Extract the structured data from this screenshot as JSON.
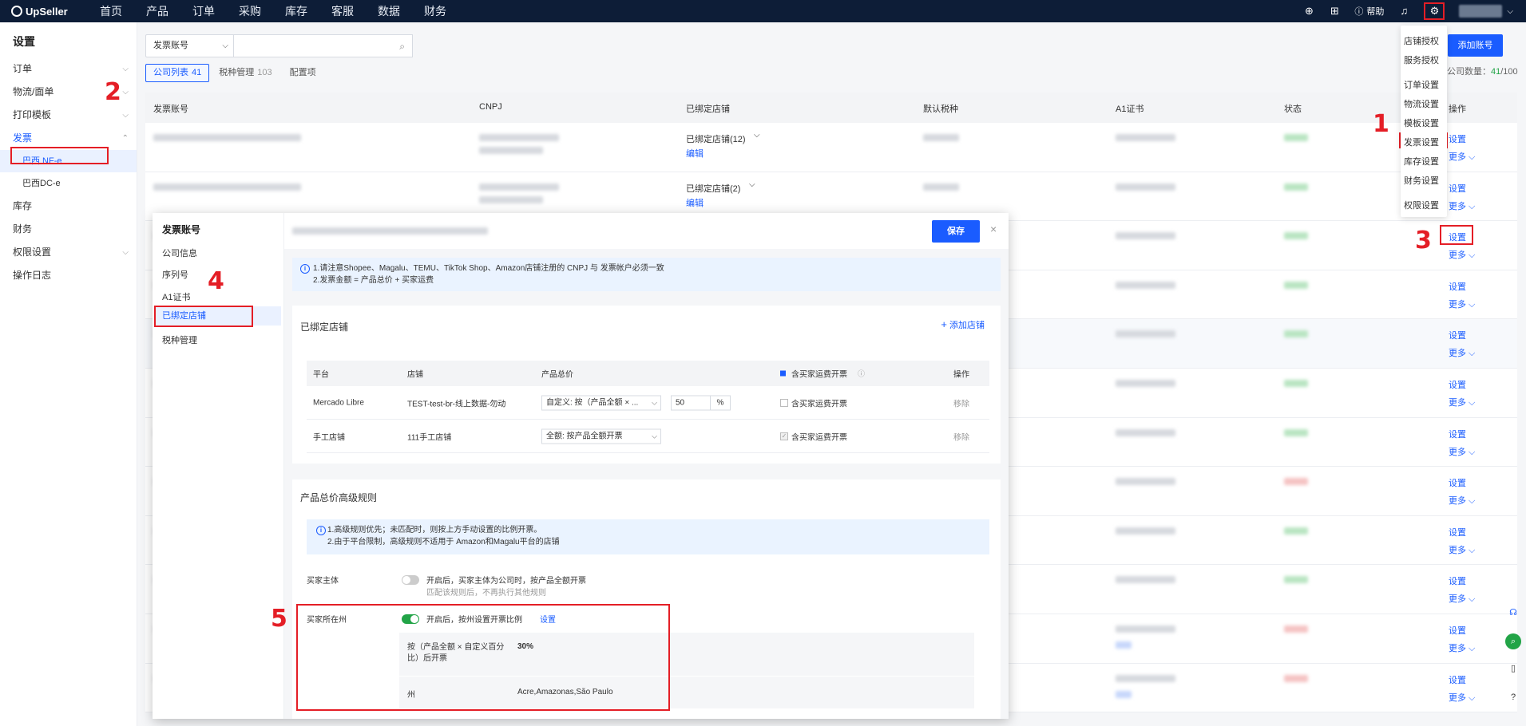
{
  "nav": {
    "logo": "UpSeller",
    "items": [
      "首页",
      "产品",
      "订单",
      "采购",
      "库存",
      "客服",
      "数据",
      "财务"
    ],
    "help": "帮助"
  },
  "sidebar": {
    "title": "设置",
    "items": [
      {
        "label": "订单",
        "chevron": "⌵"
      },
      {
        "label": "物流/面单",
        "chevron": "⌵"
      },
      {
        "label": "打印模板",
        "chevron": "⌵"
      },
      {
        "label": "发票",
        "chevron": "⌃"
      },
      {
        "label": "库存",
        "chevron": ""
      },
      {
        "label": "财务",
        "chevron": ""
      },
      {
        "label": "权限设置",
        "chevron": "⌵"
      },
      {
        "label": "操作日志",
        "chevron": ""
      }
    ],
    "subitems": [
      "巴西 NF-e",
      "巴西DC-e"
    ]
  },
  "search": {
    "type": "发票账号",
    "placeholder": ""
  },
  "tabs": [
    {
      "label": "公司列表",
      "count": "41"
    },
    {
      "label": "税种管理",
      "count": "103"
    },
    {
      "label": "配置项",
      "count": ""
    }
  ],
  "add_account": "添加账号",
  "company_count": {
    "label": "公司数量：",
    "value": "41",
    "max": "/100"
  },
  "table": {
    "headers": [
      "发票账号",
      "CNPJ",
      "已绑定店铺",
      "默认税种",
      "A1证书",
      "状态",
      "操作"
    ],
    "bound_stores": [
      "已绑定店铺(12)",
      "已绑定店铺(2)"
    ],
    "edit": "编辑",
    "set": "设置",
    "more": "更多"
  },
  "dropdown": [
    "店铺授权",
    "服务授权",
    "订单设置",
    "物流设置",
    "模板设置",
    "发票设置",
    "库存设置",
    "财务设置",
    "权限设置"
  ],
  "modal": {
    "left_title": "发票账号",
    "left_items": [
      "公司信息",
      "序列号",
      "A1证书",
      "已绑定店铺",
      "税种管理"
    ],
    "save": "保存",
    "notice": [
      "1.请注意Shopee、Magalu、TEMU、TikTok Shop、Amazon店铺注册的 CNPJ 与 发票帐户必须一致",
      "2.发票金额 = 产品总价 + 买家运费"
    ],
    "bound_title": "已绑定店铺",
    "add_store": "添加店铺",
    "store_headers": [
      "平台",
      "店铺",
      "产品总价",
      "含买家运费开票",
      "操作"
    ],
    "stores": [
      {
        "platform": "Mercado Libre",
        "store": "TEST-test-br-线上数据-勿动",
        "price_rule": "自定义: 按（产品全额 × ...",
        "percent": "50",
        "percent_unit": "%",
        "freight": "含买家运费开票",
        "action": "移除"
      },
      {
        "platform": "手工店铺",
        "store": "111手工店铺",
        "price_rule": "全额: 按产品全额开票",
        "percent": "",
        "percent_unit": "",
        "freight": "含买家运费开票",
        "action": "移除"
      }
    ],
    "adv_title": "产品总价高级规则",
    "adv_notice": [
      "1.高级规则优先；未匹配时，则按上方手动设置的比例开票。",
      "2.由于平台限制，高级规则不适用于 Amazon和Magalu平台的店铺"
    ],
    "buyer_entity": {
      "label": "买家主体",
      "text": "开启后，买家主体为公司时，按产品全额开票",
      "sub": "匹配该规则后，不再执行其他规则"
    },
    "buyer_state": {
      "label": "买家所在州",
      "text": "开启后，按州设置开票比例",
      "link": "设置"
    },
    "rule_rows": [
      {
        "label": "按（产品全额 × 自定义百分比）后开票",
        "value": "30%"
      },
      {
        "label": "州",
        "value": "Acre,Amazonas,São Paulo"
      }
    ]
  },
  "annotations": [
    "1",
    "2",
    "3",
    "4",
    "5"
  ],
  "colors": {
    "primary": "#1a5cff",
    "nav_bg": "#0d1d37",
    "annotation": "#e41e26",
    "success": "#22a447"
  }
}
